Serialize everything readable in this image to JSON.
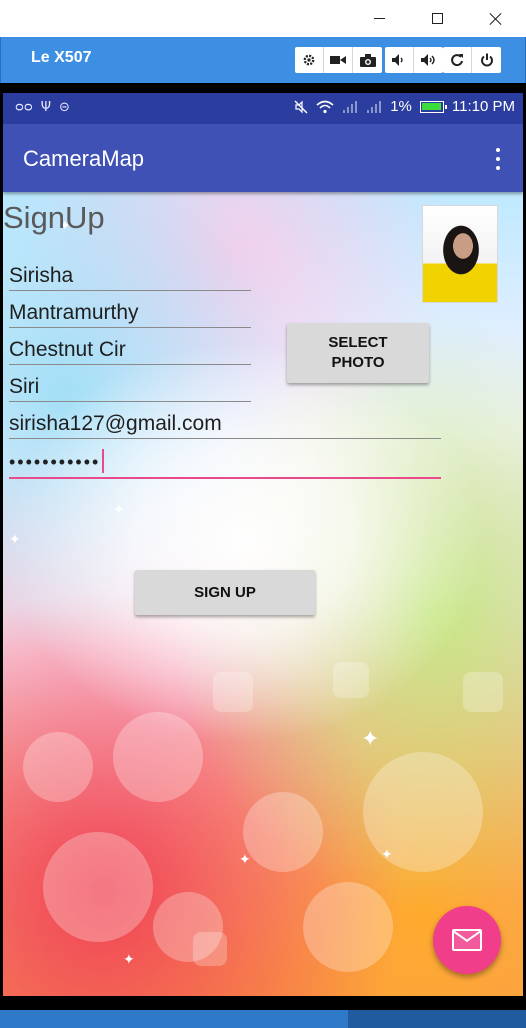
{
  "window": {
    "title": "Le X507"
  },
  "emulator_toolbar": {
    "groups": [
      [
        "gear-icon",
        "video-camera-icon",
        "camera-icon"
      ],
      [
        "volume-down-icon",
        "volume-up-icon"
      ],
      [
        "rotate-icon",
        "power-icon"
      ]
    ]
  },
  "statusbar": {
    "battery": "1%",
    "time": "11:10 PM"
  },
  "appbar": {
    "title": "CameraMap"
  },
  "form": {
    "heading": "SignUp",
    "first_name": "Sirisha",
    "last_name": "Mantramurthy",
    "address": "Chestnut Cir",
    "username": "Siri",
    "email": "sirisha127@gmail.com",
    "password_mask": "•••••••••••",
    "select_photo": "SELECT\nPHOTO",
    "sign_up": "SIGN UP"
  },
  "colors": {
    "app_bar": "#3f51b5",
    "status_bar": "#2b3d9e",
    "accent": "#e84a8c",
    "fab": "#f03e8a",
    "emulator_bar": "#3d8fe3"
  }
}
